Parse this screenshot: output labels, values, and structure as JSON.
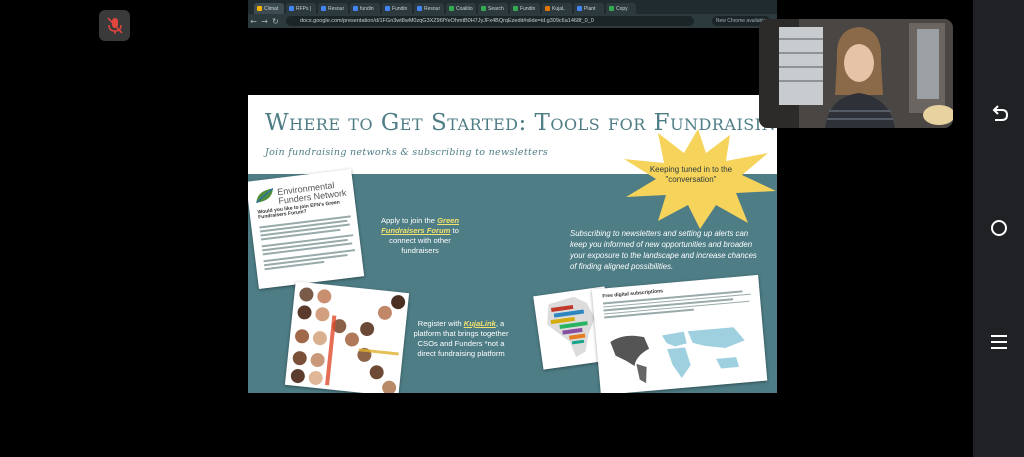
{
  "meeting": {
    "mute_icon": "mic-off-icon",
    "mute_color": "#e0463c"
  },
  "browser": {
    "tabs": [
      {
        "label": "Climat",
        "color": "#f4b400",
        "active": true
      },
      {
        "label": "RFPs |",
        "color": "#4285f4"
      },
      {
        "label": "Resour",
        "color": "#4285f4"
      },
      {
        "label": "fundin",
        "color": "#4285f4"
      },
      {
        "label": "Fundin",
        "color": "#4285f4"
      },
      {
        "label": "Resour",
        "color": "#4285f4"
      },
      {
        "label": "Coalitio",
        "color": "#34a853"
      },
      {
        "label": "Search",
        "color": "#34a853"
      },
      {
        "label": "Fundin",
        "color": "#34a853"
      },
      {
        "label": "KujaL",
        "color": "#e37400"
      },
      {
        "label": "Plant",
        "color": "#4285f4"
      },
      {
        "label": "Copy",
        "color": "#34a853"
      }
    ],
    "url": "docs.google.com/presentation/d/1FGn3wt8wM0zqG3XZ96fYeOhmtB0H7JyJFx4BQrqEzedit#slide=id.g309c6a1468f_0_0",
    "new_chrome_label": "New Chrome available"
  },
  "slide": {
    "title": "Where to Get Started: Tools for Fundraising",
    "subtitle": "Join fundraising networks & subscribing to newsletters",
    "efn_logo": "Environmental Funders Network",
    "efn_question": "Would you like to join EFN's Green Fundraisers Forum?",
    "gff_pre": "Apply to join the ",
    "gff_link": "Green Fundraisers Forum",
    "gff_post": " to connect with other fundraisers",
    "kuja_pre": "Register with ",
    "kuja_link": "KujaLink",
    "kuja_post": ", a platform that brings together CSOs and Funders *not a direct fundraising platform",
    "starburst": "Keeping tuned in to the \"conversation\"",
    "alerts": "Subscribing to newsletters and setting up alerts can keep you informed of new opportunities and broaden your exposure to the landscape and increase chances of finding aligned possibilities.",
    "map_title": "Free digital subscriptions"
  },
  "colors": {
    "teal": "#4e7d86",
    "star": "#f6d35b",
    "link_yellow": "#f3e26c"
  },
  "system_nav": {
    "back_icon": "back-icon",
    "home_icon": "home-icon",
    "recents_icon": "recents-icon"
  }
}
